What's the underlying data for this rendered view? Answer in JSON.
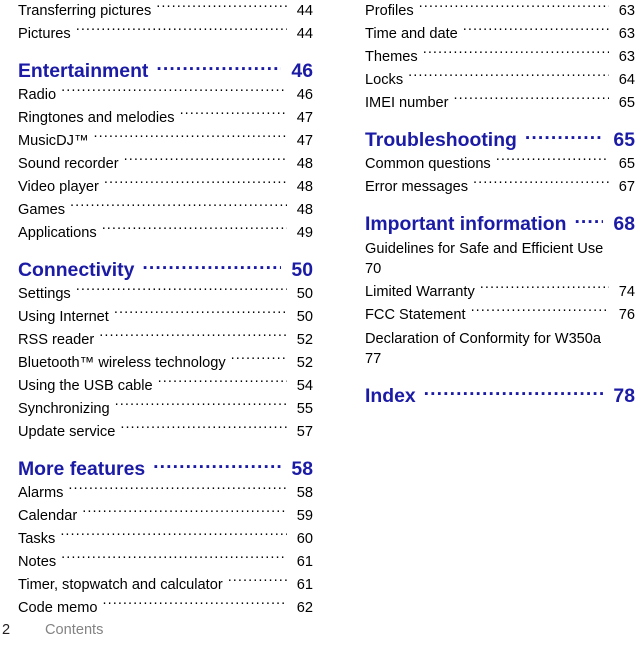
{
  "document": {
    "footer": {
      "page_number": "2",
      "title": "Contents"
    }
  },
  "left_column": {
    "entries": [
      {
        "kind": "entry",
        "label": "Transferring pictures",
        "page": "44"
      },
      {
        "kind": "entry",
        "label": "Pictures",
        "page": "44"
      },
      {
        "kind": "heading",
        "label": "Entertainment",
        "page": "46"
      },
      {
        "kind": "entry",
        "label": "Radio",
        "page": "46"
      },
      {
        "kind": "entry",
        "label": "Ringtones and melodies",
        "page": "47"
      },
      {
        "kind": "entry",
        "label": "MusicDJ™",
        "page": "47"
      },
      {
        "kind": "entry",
        "label": "Sound recorder",
        "page": "48"
      },
      {
        "kind": "entry",
        "label": "Video player",
        "page": "48"
      },
      {
        "kind": "entry",
        "label": "Games",
        "page": "48"
      },
      {
        "kind": "entry",
        "label": "Applications",
        "page": "49"
      },
      {
        "kind": "heading",
        "label": "Connectivity",
        "page": "50"
      },
      {
        "kind": "entry",
        "label": "Settings",
        "page": "50"
      },
      {
        "kind": "entry",
        "label": "Using Internet",
        "page": "50"
      },
      {
        "kind": "entry",
        "label": "RSS reader",
        "page": "52"
      },
      {
        "kind": "entry",
        "label": "Bluetooth™ wireless technology",
        "page": "52"
      },
      {
        "kind": "entry",
        "label": "Using the USB cable",
        "page": "54"
      },
      {
        "kind": "entry",
        "label": "Synchronizing",
        "page": "55"
      },
      {
        "kind": "entry",
        "label": "Update service",
        "page": "57"
      },
      {
        "kind": "heading",
        "label": "More features",
        "page": "58"
      },
      {
        "kind": "entry",
        "label": "Alarms",
        "page": "58"
      },
      {
        "kind": "entry",
        "label": "Calendar",
        "page": "59"
      },
      {
        "kind": "entry",
        "label": "Tasks",
        "page": "60"
      },
      {
        "kind": "entry",
        "label": "Notes",
        "page": "61"
      },
      {
        "kind": "entry",
        "label": "Timer, stopwatch and calculator",
        "page": "61"
      },
      {
        "kind": "entry",
        "label": "Code memo",
        "page": "62"
      }
    ]
  },
  "right_column": {
    "entries": [
      {
        "kind": "entry",
        "label": "Profiles",
        "page": "63"
      },
      {
        "kind": "entry",
        "label": "Time and date",
        "page": "63"
      },
      {
        "kind": "entry",
        "label": "Themes",
        "page": "63"
      },
      {
        "kind": "entry",
        "label": "Locks",
        "page": "64"
      },
      {
        "kind": "entry",
        "label": "IMEI number",
        "page": "65"
      },
      {
        "kind": "heading",
        "label": "Troubleshooting",
        "page": "65"
      },
      {
        "kind": "entry",
        "label": "Common questions",
        "page": "65"
      },
      {
        "kind": "entry",
        "label": "Error messages",
        "page": "67"
      },
      {
        "kind": "heading",
        "label": "Important information",
        "page": "68"
      },
      {
        "kind": "wrapped",
        "label": "Guidelines for Safe and Efficient Use",
        "page": "70"
      },
      {
        "kind": "entry",
        "label": "Limited Warranty",
        "page": "74"
      },
      {
        "kind": "entry",
        "label": "FCC Statement",
        "page": "76"
      },
      {
        "kind": "wrapped",
        "label": "Declaration of Conformity for W350a",
        "page": "77"
      },
      {
        "kind": "heading",
        "label": "Index",
        "page": "78"
      }
    ]
  },
  "colors": {
    "heading_blue": "#1b1ba6",
    "body_text": "#000000",
    "footer_gray": "#838383"
  }
}
